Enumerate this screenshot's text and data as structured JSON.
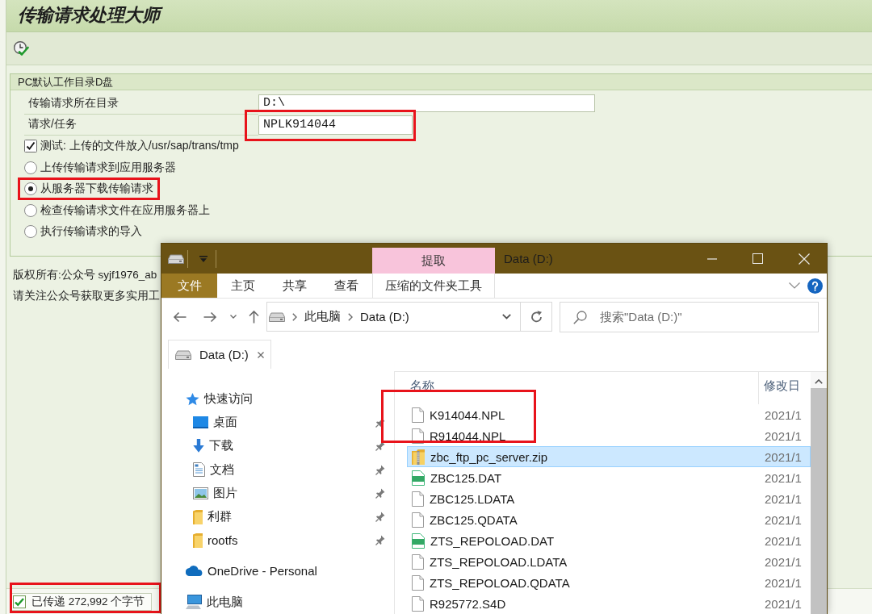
{
  "sap": {
    "title": "传输请求处理大师",
    "group": {
      "title": "PC默认工作目录D盘",
      "fields": [
        {
          "label": "传输请求所在目录",
          "value": "D:\\",
          "highlighted": false
        },
        {
          "label": "请求/任务",
          "value": "NPLK914044",
          "highlighted": true
        }
      ],
      "test_option": {
        "label": "测试: 上传的文件放入/usr/sap/trans/tmp",
        "checked": true
      },
      "radios": [
        {
          "label": "上传传输请求到应用服务器",
          "selected": false,
          "highlighted": false
        },
        {
          "label": "从服务器下载传输请求",
          "selected": true,
          "highlighted": true
        },
        {
          "label": "检查传输请求文件在应用服务器上",
          "selected": false,
          "highlighted": false
        },
        {
          "label": "执行传输请求的导入",
          "selected": false,
          "highlighted": false
        }
      ]
    },
    "notes": [
      "版权所有:公众号 syjf1976_ab",
      "请关注公众号获取更多实用工"
    ],
    "status": {
      "kind": "success",
      "message": "已传递 272,992 个字节",
      "highlighted": true
    }
  },
  "explorer": {
    "title": "Data (D:)",
    "context_label": "提取",
    "ribbon_tabs": [
      {
        "label": "文件",
        "kind": "file"
      },
      {
        "label": "主页",
        "kind": "tab"
      },
      {
        "label": "共享",
        "kind": "tab"
      },
      {
        "label": "查看",
        "kind": "tab"
      },
      {
        "label": "压缩的文件夹工具",
        "kind": "context"
      }
    ],
    "breadcrumbs": [
      "此电脑",
      "Data (D:)"
    ],
    "search": {
      "placeholder": "搜索\"Data (D:)\""
    },
    "tabs": [
      {
        "label": "Data (D:)",
        "selected": true
      }
    ],
    "nav": [
      {
        "label": "快速访问",
        "kind": "quick",
        "pinned": false,
        "children": [
          {
            "label": "桌面",
            "kind": "desktop",
            "pinned": true
          },
          {
            "label": "下载",
            "kind": "downloads",
            "pinned": true
          },
          {
            "label": "文档",
            "kind": "documents",
            "pinned": true
          },
          {
            "label": "图片",
            "kind": "pictures",
            "pinned": true
          },
          {
            "label": "利群",
            "kind": "folder",
            "pinned": true
          },
          {
            "label": "rootfs",
            "kind": "folder",
            "pinned": true
          }
        ]
      },
      {
        "label": "OneDrive - Personal",
        "kind": "cloud",
        "pinned": false
      },
      {
        "label": "此电脑",
        "kind": "computer",
        "pinned": false
      }
    ],
    "columns": [
      "名称",
      "修改日"
    ],
    "files": [
      {
        "name": "K914044.NPL",
        "kind": "document",
        "modified": "2021/1",
        "selected": false,
        "highlighted": true
      },
      {
        "name": "R914044.NPL",
        "kind": "document",
        "modified": "2021/1",
        "selected": false,
        "highlighted": true
      },
      {
        "name": "zbc_ftp_pc_server.zip",
        "kind": "archive",
        "modified": "2021/1",
        "selected": true,
        "highlighted": false
      },
      {
        "name": "ZBC125.DAT",
        "kind": "media",
        "modified": "2021/1",
        "selected": false,
        "highlighted": false
      },
      {
        "name": "ZBC125.LDATA",
        "kind": "document",
        "modified": "2021/1",
        "selected": false,
        "highlighted": false
      },
      {
        "name": "ZBC125.QDATA",
        "kind": "document",
        "modified": "2021/1",
        "selected": false,
        "highlighted": false
      },
      {
        "name": "ZTS_REPOLOAD.DAT",
        "kind": "media",
        "modified": "2021/1",
        "selected": false,
        "highlighted": false
      },
      {
        "name": "ZTS_REPOLOAD.LDATA",
        "kind": "document",
        "modified": "2021/1",
        "selected": false,
        "highlighted": false
      },
      {
        "name": "ZTS_REPOLOAD.QDATA",
        "kind": "document",
        "modified": "2021/1",
        "selected": false,
        "highlighted": false
      },
      {
        "name": "R925772.S4D",
        "kind": "document",
        "modified": "2021/1",
        "selected": false,
        "highlighted": false
      }
    ]
  }
}
